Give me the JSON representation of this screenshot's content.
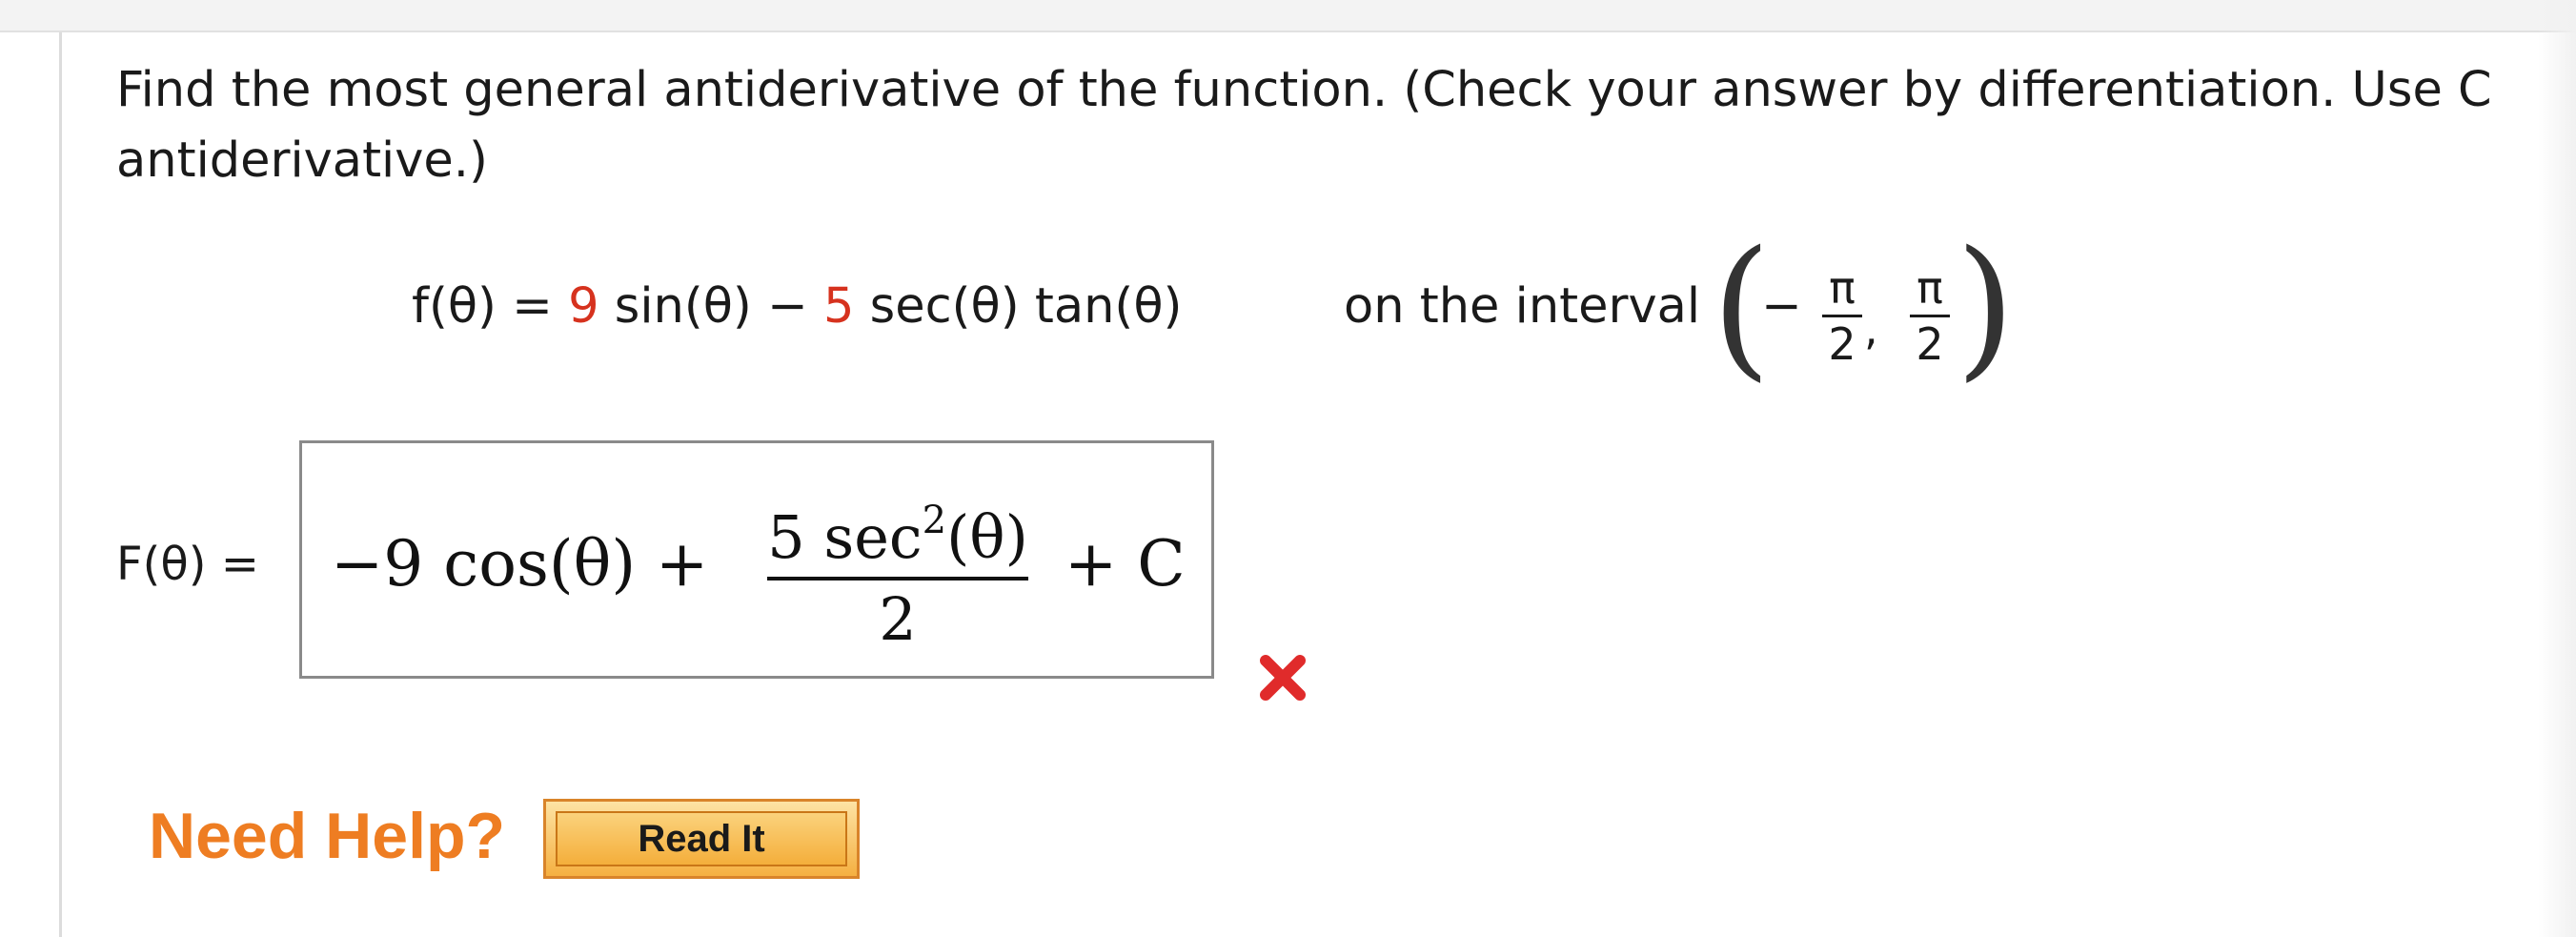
{
  "question": {
    "line1": "Find the most general antiderivative of the function. (Check your answer by differentiation. Use C",
    "line2": "antiderivative.)"
  },
  "function": {
    "lhs": "f(θ) = ",
    "coef1": "9",
    "term1": " sin(θ) − ",
    "coef2": "5",
    "term2": " sec(θ) tan(θ)"
  },
  "interval": {
    "label": "on the interval",
    "minus": "−",
    "num1": "π",
    "den1": "2",
    "comma": ",",
    "num2": "π",
    "den2": "2"
  },
  "answer": {
    "label": "F(θ) =",
    "part1": "−9 cos(θ) + ",
    "frac_num": "5 sec",
    "frac_exp": "2",
    "frac_num_tail": "(θ)",
    "frac_den": "2",
    "part2": "+ C",
    "status_icon": "incorrect-x-icon",
    "status_color": "#e02b2b"
  },
  "help": {
    "label": "Need Help?",
    "button": "Read It",
    "label_color": "#ee7d22"
  }
}
